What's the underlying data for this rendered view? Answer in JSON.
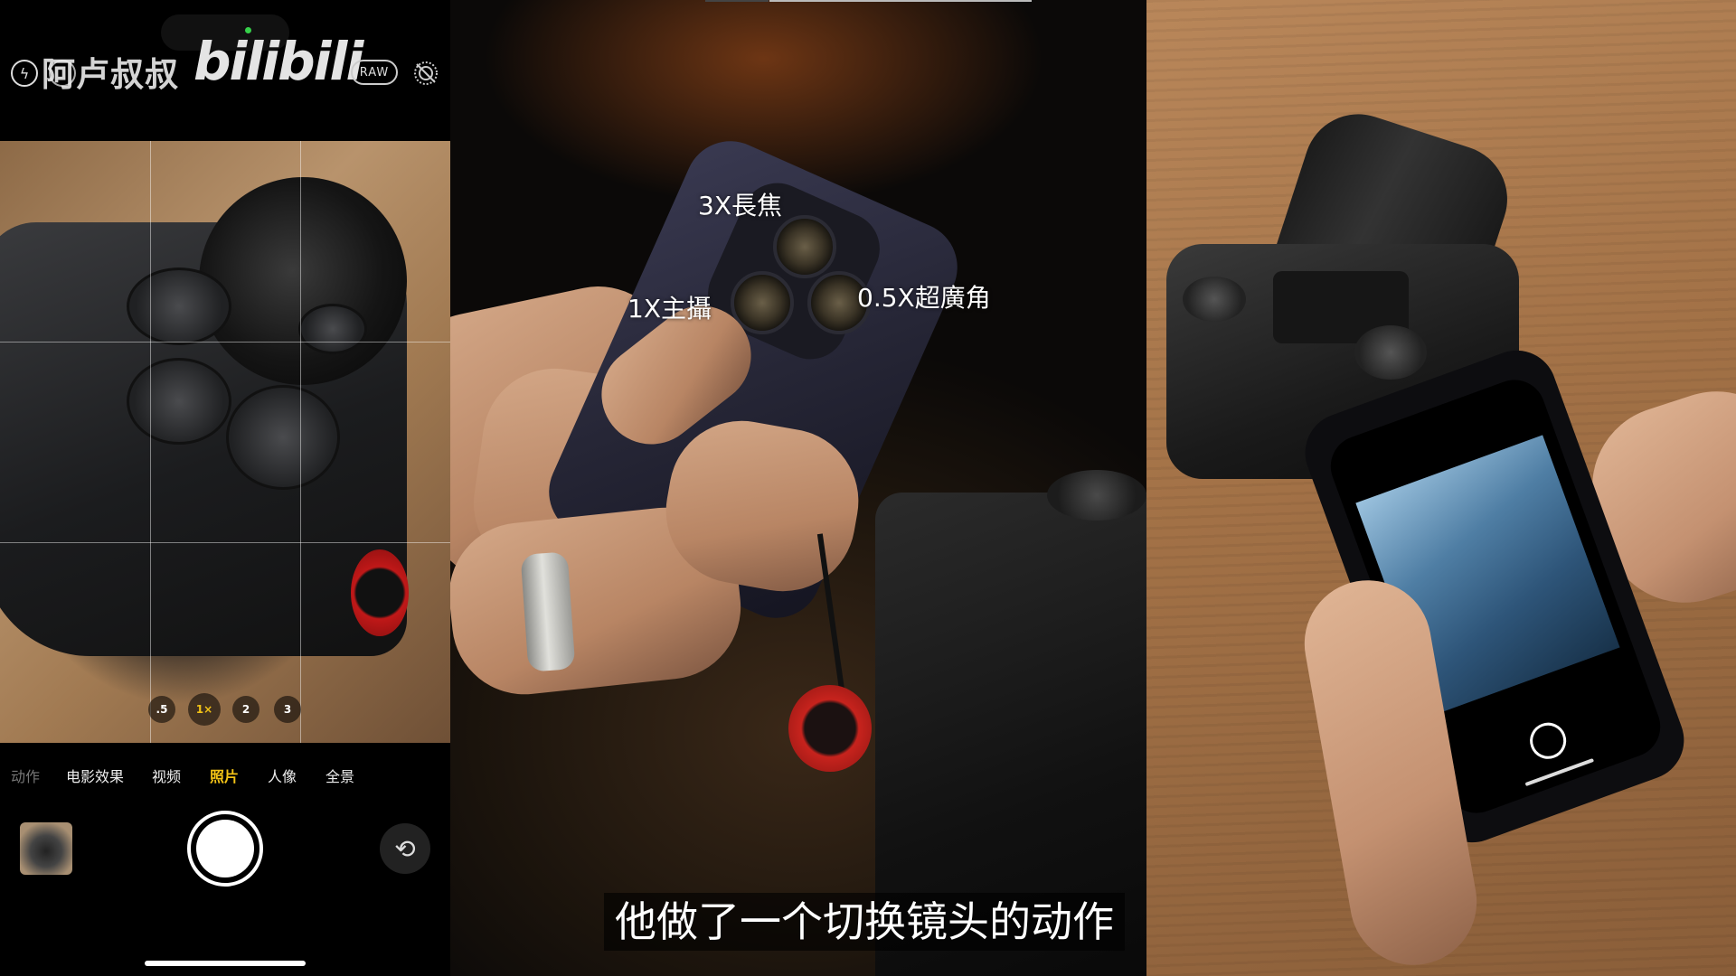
{
  "left_phone": {
    "watermark": {
      "name": "阿卢叔叔",
      "logo": "bilibili"
    },
    "raw_label": "RAW",
    "flash_icon": "lightning-icon",
    "zoom_levels": [
      ".5",
      "1×",
      "2",
      "3"
    ],
    "active_zoom": "1×",
    "modes": [
      "动作",
      "电影效果",
      "视频",
      "照片",
      "人像",
      "全景"
    ],
    "active_mode": "照片",
    "accent_color": "#f3c316"
  },
  "middle": {
    "lens_labels": {
      "tele": "3X長焦",
      "main": "1X主攝",
      "ultrawide": "0.5X超廣角"
    },
    "subtitle": "他做了一个切换镜头的动作"
  }
}
